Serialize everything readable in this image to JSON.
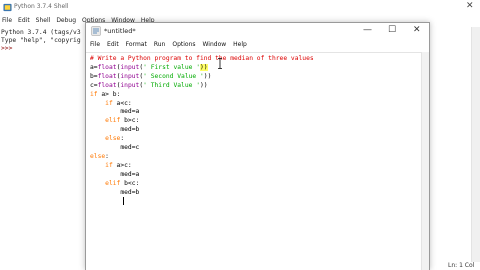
{
  "shell": {
    "title": "Python 3.7.4 Shell",
    "menu": [
      "File",
      "Edit",
      "Shell",
      "Debug",
      "Options",
      "Window",
      "Help"
    ],
    "lines": [
      "Python 3.7.4 (tags/v3",
      "Type \"help\", \"copyrig"
    ],
    "prompt": ">>>",
    "status": "Ln: 1  Col"
  },
  "editor": {
    "title": "*untitled*",
    "controls": {
      "minimize": "—",
      "maximize": "☐",
      "close": "✕"
    },
    "menu": [
      "File",
      "Edit",
      "Format",
      "Run",
      "Options",
      "Window",
      "Help"
    ],
    "code": [
      {
        "indent": "",
        "parts": [
          {
            "t": "cm",
            "v": "# Write a Python program to find the median of three values"
          }
        ]
      },
      {
        "indent": "",
        "parts": [
          {
            "t": "",
            "v": "a="
          },
          {
            "t": "bi",
            "v": "float"
          },
          {
            "t": "",
            "v": "("
          },
          {
            "t": "bi",
            "v": "input"
          },
          {
            "t": "",
            "v": "("
          },
          {
            "t": "str",
            "v": "' First value '"
          },
          {
            "t": "hl",
            "v": "))"
          }
        ]
      },
      {
        "indent": "",
        "parts": [
          {
            "t": "",
            "v": "b="
          },
          {
            "t": "bi",
            "v": "float"
          },
          {
            "t": "",
            "v": "("
          },
          {
            "t": "bi",
            "v": "input"
          },
          {
            "t": "",
            "v": "("
          },
          {
            "t": "str",
            "v": "' Second Value '"
          },
          {
            "t": "",
            "v": "))"
          }
        ]
      },
      {
        "indent": "",
        "parts": [
          {
            "t": "",
            "v": "c="
          },
          {
            "t": "bi",
            "v": "float"
          },
          {
            "t": "",
            "v": "("
          },
          {
            "t": "bi",
            "v": "input"
          },
          {
            "t": "",
            "v": "("
          },
          {
            "t": "str",
            "v": "' Third Value '"
          },
          {
            "t": "",
            "v": "))"
          }
        ]
      },
      {
        "indent": "",
        "parts": [
          {
            "t": "kw",
            "v": "if"
          },
          {
            "t": "",
            "v": " a> b:"
          }
        ]
      },
      {
        "indent": "    ",
        "parts": [
          {
            "t": "kw",
            "v": "if"
          },
          {
            "t": "",
            "v": " a<c:"
          }
        ]
      },
      {
        "indent": "        ",
        "parts": [
          {
            "t": "",
            "v": "med=a"
          }
        ]
      },
      {
        "indent": "    ",
        "parts": [
          {
            "t": "kw",
            "v": "elif"
          },
          {
            "t": "",
            "v": " b>c:"
          }
        ]
      },
      {
        "indent": "        ",
        "parts": [
          {
            "t": "",
            "v": "med=b"
          }
        ]
      },
      {
        "indent": "    ",
        "parts": [
          {
            "t": "kw",
            "v": "else"
          },
          {
            "t": "",
            "v": ":"
          }
        ]
      },
      {
        "indent": "        ",
        "parts": [
          {
            "t": "",
            "v": "med=c"
          }
        ]
      },
      {
        "indent": "",
        "parts": [
          {
            "t": "kw",
            "v": "else"
          },
          {
            "t": "",
            "v": ":"
          }
        ]
      },
      {
        "indent": "    ",
        "parts": [
          {
            "t": "kw",
            "v": "if"
          },
          {
            "t": "",
            "v": " a>c:"
          }
        ]
      },
      {
        "indent": "        ",
        "parts": [
          {
            "t": "",
            "v": "med=a"
          }
        ]
      },
      {
        "indent": "    ",
        "parts": [
          {
            "t": "kw",
            "v": "elif"
          },
          {
            "t": "",
            "v": " b<c:"
          }
        ]
      },
      {
        "indent": "        ",
        "parts": [
          {
            "t": "",
            "v": "med=b"
          }
        ]
      },
      {
        "indent": "        ",
        "parts": [
          {
            "t": "",
            "v": ""
          }
        ]
      }
    ]
  },
  "colors": {
    "keyword": "#ff7700",
    "builtin": "#900090",
    "string": "#00aa00",
    "comment": "#dd0000",
    "highlight": "#ffff66"
  },
  "icons": [
    "python-idle-icon",
    "minimize-icon",
    "maximize-icon",
    "close-icon",
    "i-beam-cursor-icon"
  ]
}
